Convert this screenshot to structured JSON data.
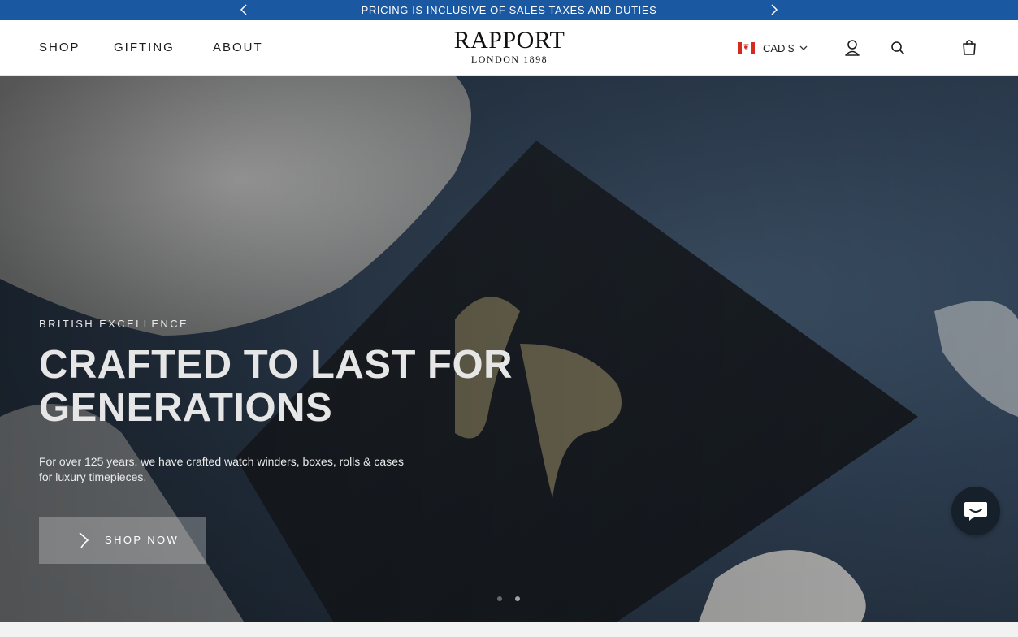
{
  "announcement": {
    "text": "PRICING IS INCLUSIVE OF SALES TAXES AND DUTIES",
    "prev_icon": "chevron-left-icon",
    "next_icon": "chevron-right-icon"
  },
  "nav": {
    "items": [
      {
        "label": "SHOP"
      },
      {
        "label": "GIFTING"
      },
      {
        "label": "ABOUT"
      }
    ]
  },
  "logo": {
    "main": "RAPPORT",
    "sub": "LONDON 1898"
  },
  "currency": {
    "flag": "canada-flag-icon",
    "label": "CAD $"
  },
  "header_icons": {
    "account": "user-icon",
    "search": "search-icon",
    "cart": "shopping-bag-icon"
  },
  "hero": {
    "eyebrow": "BRITISH EXCELLENCE",
    "headline_line1": "CRAFTED TO LAST FOR",
    "headline_line2": "GENERATIONS",
    "description_line1": "For over 125 years, we have crafted watch winders, boxes, rolls & cases",
    "description_line2": "for luxury timepieces.",
    "cta_label": "SHOP NOW",
    "slides": 2,
    "active_slide": 2
  },
  "chat": {
    "icon": "chat-bubble-icon"
  },
  "colors": {
    "announcement_bg": "#1b58a2",
    "header_bg": "#ffffff",
    "hero_text": "#e6e6e6",
    "chat_bg": "#16202b"
  }
}
